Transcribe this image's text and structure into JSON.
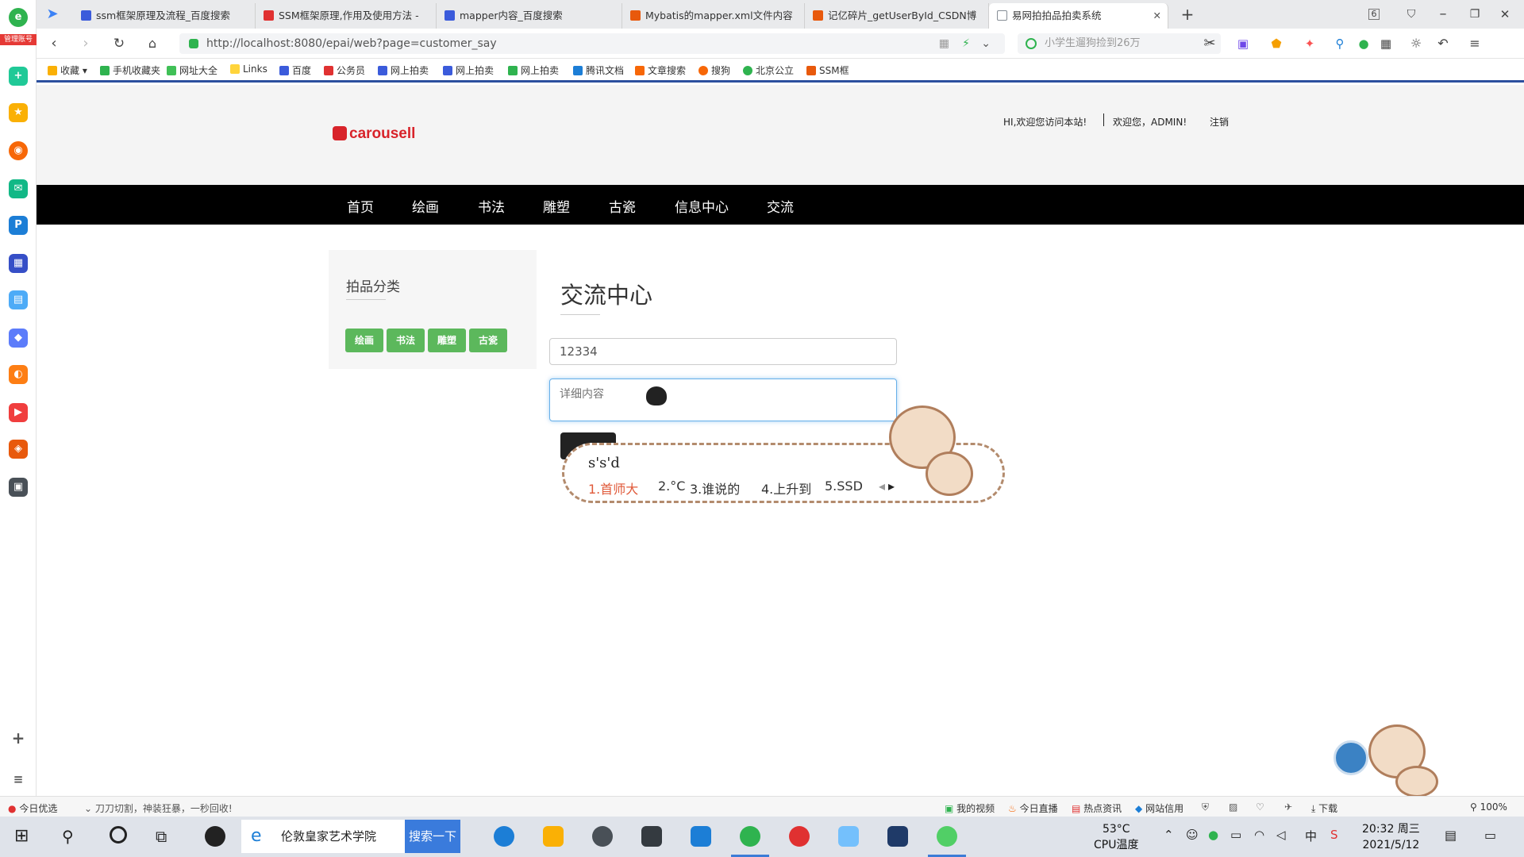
{
  "sidebar_badge": "管理账号",
  "tabs": [
    {
      "label": "ssm框架原理及流程_百度搜索",
      "color": "#3b5bdb"
    },
    {
      "label": "SSM框架原理,作用及使用方法 -",
      "color": "#e03131"
    },
    {
      "label": "mapper内容_百度搜索",
      "color": "#3b5bdb"
    },
    {
      "label": "Mybatis的mapper.xml文件内容",
      "color": "#e8590c"
    },
    {
      "label": "记亿碎片_getUserById_CSDN博",
      "color": "#e8590c"
    },
    {
      "label": "易网拍拍品拍卖系统",
      "color": "#868e96"
    }
  ],
  "tab_count": "6",
  "address": {
    "url": "http://localhost:8080/epai/web?page=customer_say",
    "search_placeholder": "小学生遛狗捡到26万"
  },
  "bookmarks": [
    "收藏",
    "手机收藏夹",
    "网址大全",
    "Links",
    "百度",
    "公务员",
    "网上拍卖",
    "网上拍卖",
    "网上拍卖",
    "腾讯文档",
    "文章搜索",
    "搜狗",
    "北京公立",
    "SSM框"
  ],
  "header": {
    "logo_text": "carousell",
    "greeting": "HI,欢迎您访问本站!",
    "welcome": "欢迎您，ADMIN!",
    "logout": "注销"
  },
  "menu": [
    "首页",
    "绘画",
    "书法",
    "雕塑",
    "古瓷",
    "信息中心",
    "交流"
  ],
  "side": {
    "title": "拍品分类",
    "categories": [
      "绘画",
      "书法",
      "雕塑",
      "古瓷"
    ]
  },
  "main": {
    "title": "交流中心",
    "title_input_value": "12334",
    "content_placeholder": "详细内容"
  },
  "ime": {
    "typed": "s's'd",
    "candidates": [
      "1.首师大",
      "2.°C",
      "3.谁说的",
      "4.上升到",
      "5.SSD"
    ]
  },
  "statusbar": {
    "left1": "今日优选",
    "left2": "刀刀切割，神装狂暴，一秒回收!",
    "items": [
      "我的视频",
      "今日直播",
      "热点资讯",
      "网站信用",
      "下载",
      "100%"
    ]
  },
  "taskbar": {
    "search_text": "伦敦皇家艺术学院",
    "search_button": "搜索一下",
    "temp": "53°C",
    "temp_label": "CPU温度",
    "time": "20:32 周三",
    "date": "2021/5/12"
  }
}
